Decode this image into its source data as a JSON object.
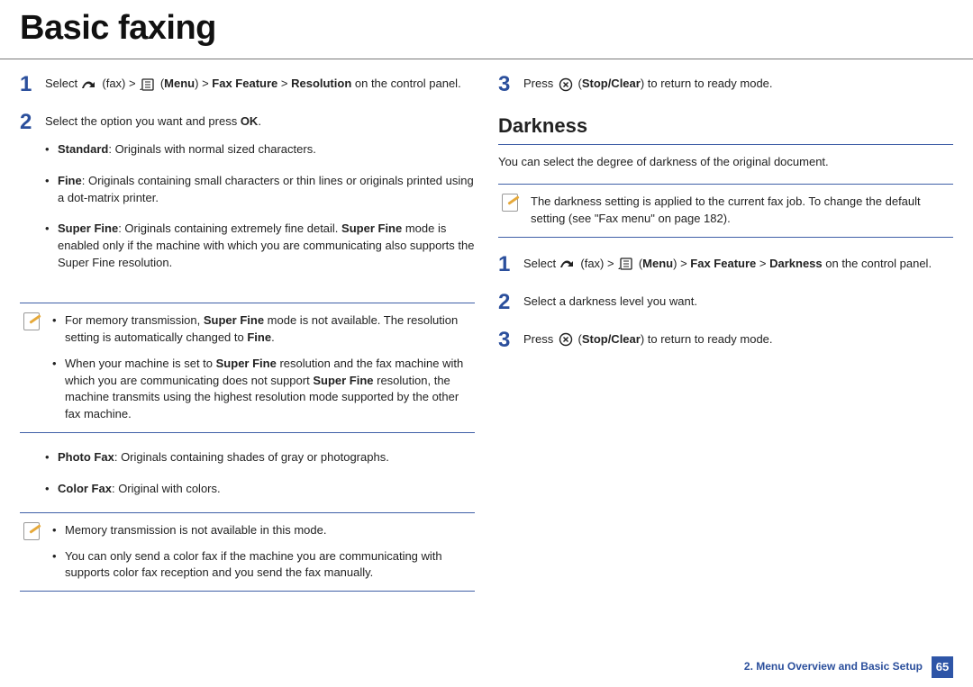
{
  "title": "Basic faxing",
  "left": {
    "step1": {
      "num": "1",
      "pre": "Select ",
      "fax_label": "(fax) > ",
      "menu_label": "(",
      "menu_bold": "Menu",
      "path_sep": ") > ",
      "path1": "Fax Feature",
      "gt": " > ",
      "path2": "Resolution",
      "tail": " on the control panel."
    },
    "step2": {
      "num": "2",
      "lead": "Select the option you want and press ",
      "ok": "OK",
      "period": ".",
      "opts": {
        "std_label": "Standard",
        "std_text": ": Originals with normal sized characters.",
        "fine_label": "Fine",
        "fine_text": ": Originals containing small characters or thin lines or originals printed using a dot-matrix printer.",
        "sfine_label": "Super Fine",
        "sfine_text1": ": Originals containing extremely fine detail. ",
        "sfine_bold2": "Super Fine",
        "sfine_text2": " mode is enabled only if the machine with which you are communicating also supports the Super Fine resolution."
      }
    },
    "note1": {
      "a_pre": "For memory transmission, ",
      "a_b1": "Super Fine",
      "a_mid": " mode is not available. The resolution setting is automatically changed to ",
      "a_b2": "Fine",
      "a_tail": ".",
      "b_pre": "When your machine is set to ",
      "b_b1": "Super Fine",
      "b_mid1": " resolution and the fax machine with which you are communicating does not support ",
      "b_b2": "Super Fine",
      "b_tail": " resolution, the machine transmits using the highest resolution mode supported by the other fax machine."
    },
    "opts2": {
      "photo_label": "Photo Fax",
      "photo_text": ": Originals containing shades of gray or photographs.",
      "color_label": "Color Fax",
      "color_text": ": Original with colors."
    },
    "note2": {
      "a": "Memory transmission is not available in this mode.",
      "b": "You can only send a color fax if the machine you are communicating with supports color fax reception and you send the fax manually."
    }
  },
  "right": {
    "step0": {
      "num": "3",
      "pre": "Press ",
      "stop_label": "(",
      "stop_bold": "Stop/Clear",
      "stop_tail": ") to return to ready mode."
    },
    "subhead": "Darkness",
    "intro": "You can select the degree of darkness of the original document.",
    "note": "The darkness setting is applied to the current fax job. To change the default setting (see \"Fax menu\" on page 182).",
    "step1": {
      "num": "1",
      "pre": "Select ",
      "fax_label": "(fax) > ",
      "menu_label": "(",
      "menu_bold": "Menu",
      "path_sep": ") > ",
      "path1": "Fax Feature",
      "gt": " > ",
      "path2": "Darkness",
      "tail": " on the control panel."
    },
    "step2": {
      "num": "2",
      "text": "Select a darkness level you want."
    },
    "step3": {
      "num": "3",
      "pre": "Press ",
      "stop_label": "(",
      "stop_bold": "Stop/Clear",
      "stop_tail": ") to return to ready mode."
    }
  },
  "footer": {
    "chapter": "2. Menu Overview and Basic Setup",
    "page": "65"
  }
}
